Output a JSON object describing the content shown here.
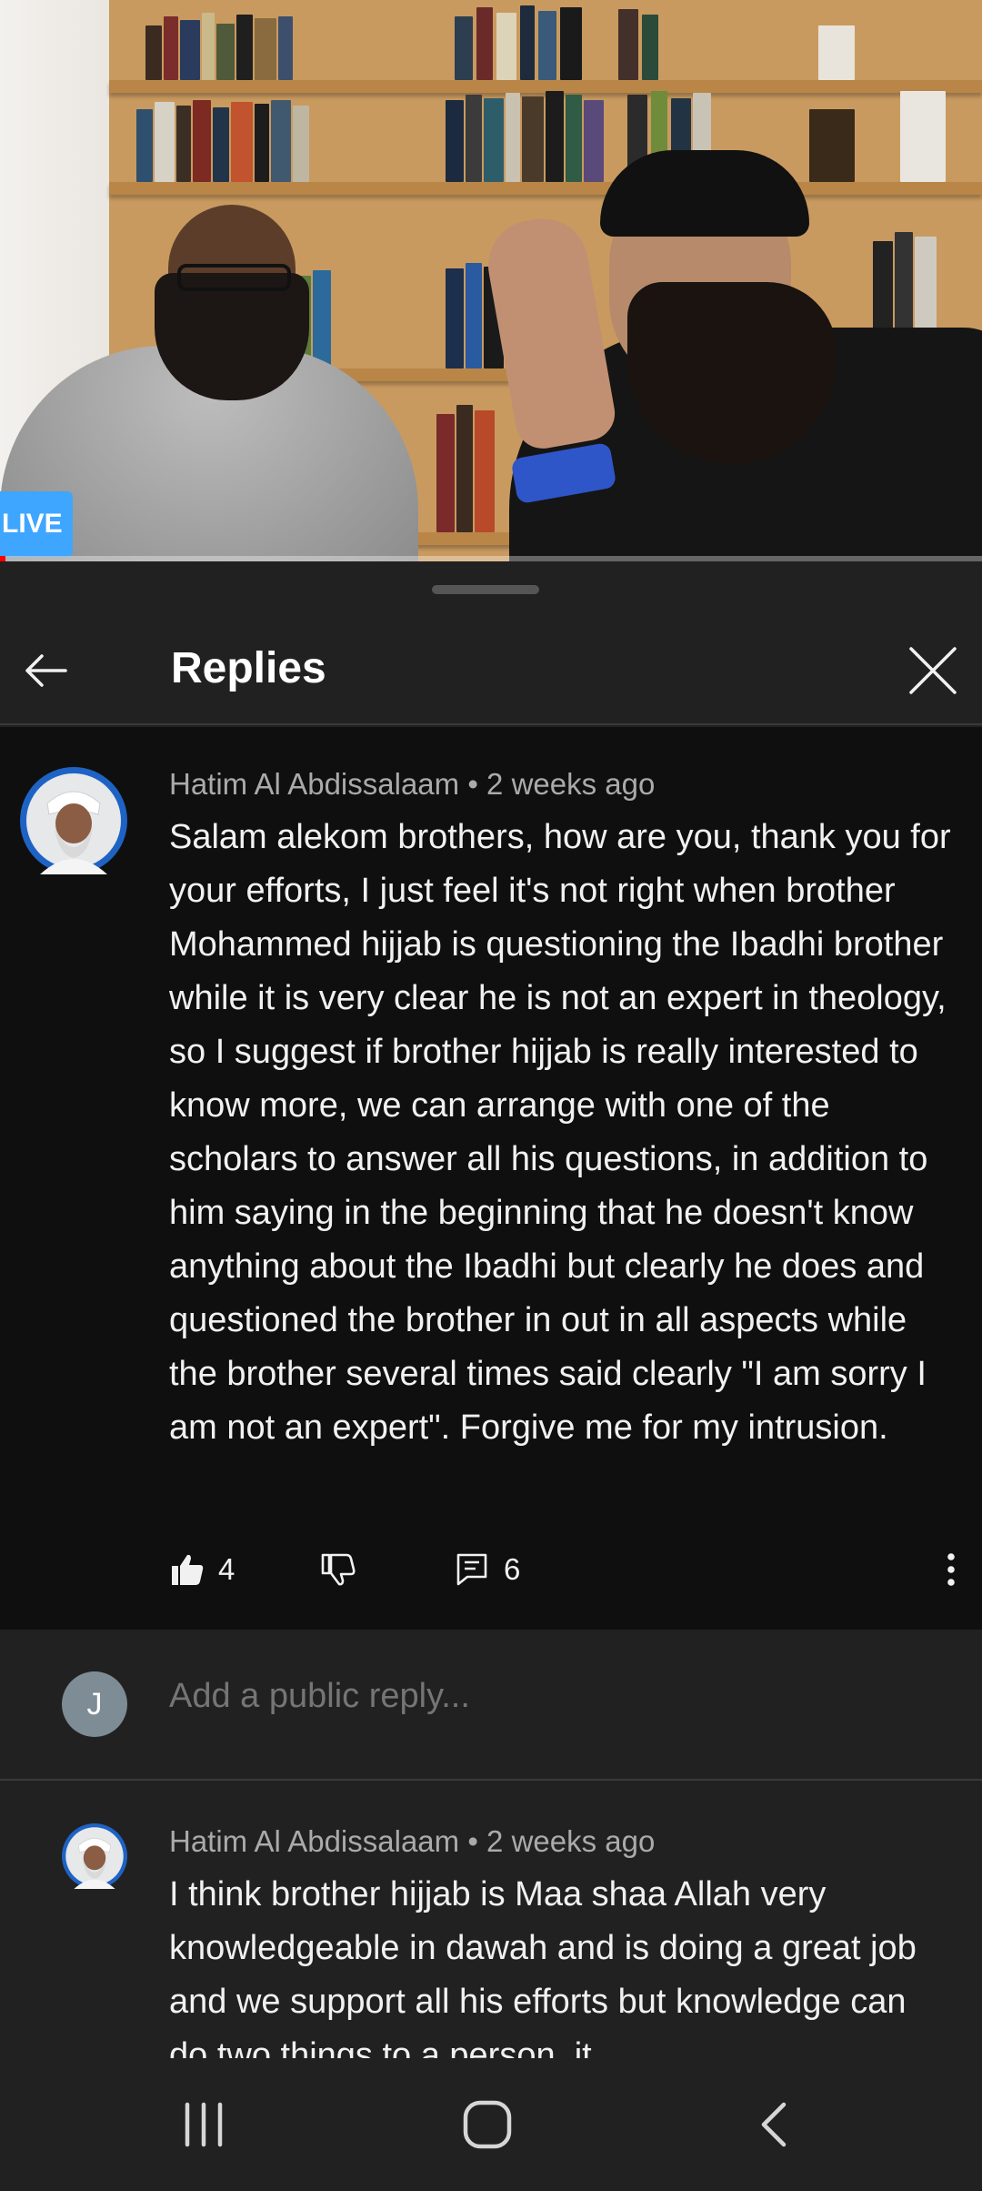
{
  "video": {
    "live_label": "LIVE"
  },
  "header": {
    "title": "Replies"
  },
  "comment": {
    "author": "Hatim Al Abdissalaam",
    "time": "2 weeks ago",
    "text": "Salam alekom brothers, how are you, thank you for your efforts, I just feel it's not right when brother Mohammed hijjab is questioning the Ibadhi brother while it is very clear he is not an expert in theology, so I suggest if brother hijjab is really interested to know more, we can arrange with one of the scholars to answer all his questions, in addition to him saying in the beginning that he doesn't know anything about the Ibadhi but clearly he does and questioned the brother in out in all aspects while the brother several times said clearly \"I am sorry I am not an expert\". Forgive me for my intrusion.",
    "likes": "4",
    "replies": "6"
  },
  "composer": {
    "avatar_letter": "J",
    "placeholder": "Add a public reply..."
  },
  "reply": {
    "author": "Hatim Al Abdissalaam",
    "time": "2 weeks ago",
    "text": "I think brother hijjab is Maa shaa Allah very knowledgeable in dawah and is doing a great job and we support all his efforts but knowledge can do two things to a person, it"
  },
  "icons": {
    "back": "arrow-left-icon",
    "close": "close-icon",
    "like": "thumbs-up-icon",
    "dislike": "thumbs-down-icon",
    "reply": "comment-icon",
    "more": "more-vert-icon"
  },
  "colors": {
    "background": "#0f0f0f",
    "sheet": "#212121",
    "live": "#3ea6ff",
    "meta": "#aaaaaa"
  }
}
